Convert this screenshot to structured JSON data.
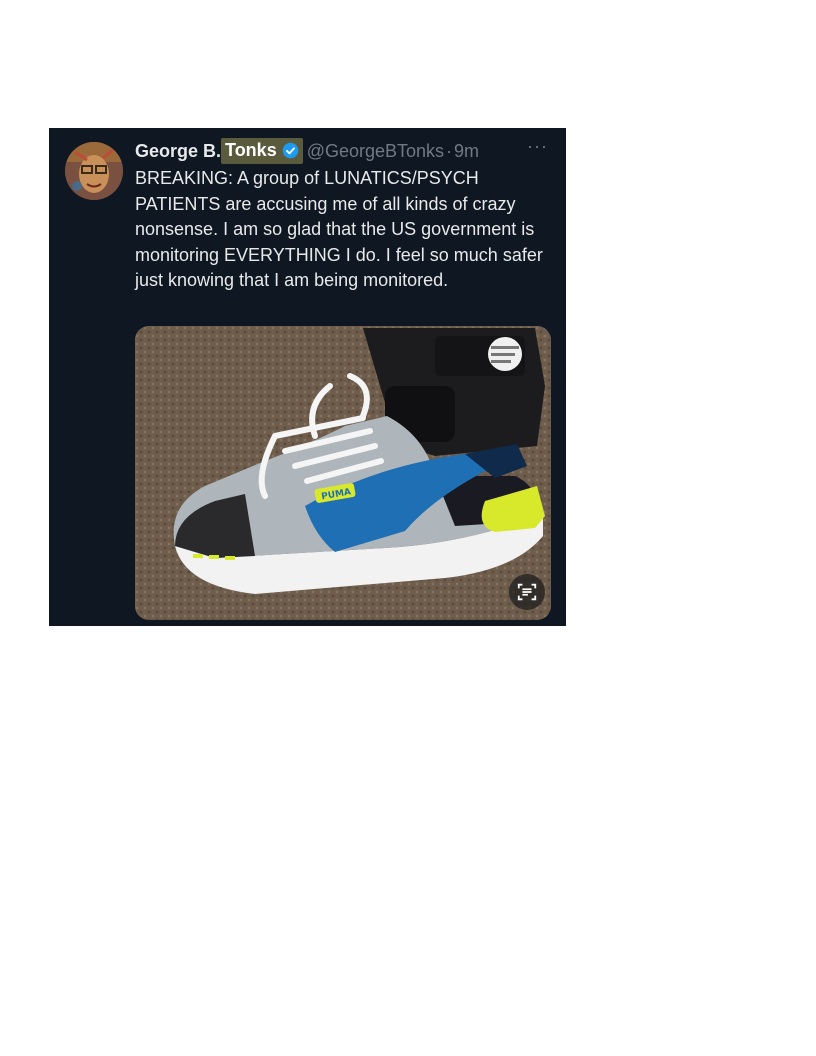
{
  "tweet": {
    "author_first": "George B.",
    "author_highlight": "Tonks",
    "handle": "@GeorgeBTonks",
    "separator": "·",
    "time": "9m",
    "more": "···",
    "text": "BREAKING: A group of LUNATICS/PSYCH PATIENTS are accusing me of all kinds of crazy nonsense. I am so glad that the US government is monitoring EVERYTHING I do. I feel so much safer just knowing that I am being monitored."
  },
  "media": {
    "brand_label": "PUMA"
  },
  "icons": {
    "avatar": "avatar",
    "verified": "verified-badge-icon",
    "lens": "image-text-scan-icon"
  },
  "colors": {
    "background": "#0f1722",
    "text": "#e7e9ea",
    "muted": "#6f7a85",
    "verified": "#1d9bf0",
    "highlight": "#5a5a3c"
  }
}
